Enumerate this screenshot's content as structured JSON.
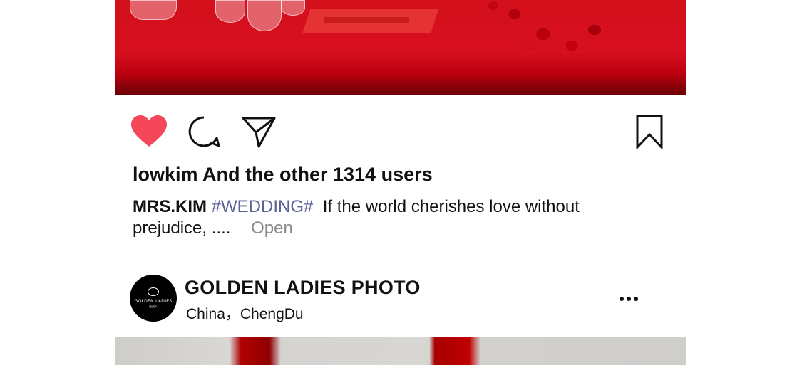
{
  "post": {
    "liked_by_text": "lowkim And the other 1314 users",
    "caption_user": "MRS.KIM",
    "caption_tag": "#WEDDING#",
    "caption_text": "If the world cherishes love without prejudice, ....",
    "open_label": "Open",
    "like_active": true,
    "colors": {
      "like": "#f4485a",
      "tag": "#5c6196",
      "open": "#8a8a8a"
    }
  },
  "actions": {
    "icons": [
      "heart-icon",
      "comment-icon",
      "share-icon",
      "bookmark-icon"
    ]
  },
  "next_post": {
    "account_name": "GOLDEN LADIES PHOTO",
    "location": "China，ChengDu",
    "avatar_brand": "GOLDEN LADIES",
    "avatar_sub": "金夫人",
    "more_icon": "more-dots-icon"
  }
}
